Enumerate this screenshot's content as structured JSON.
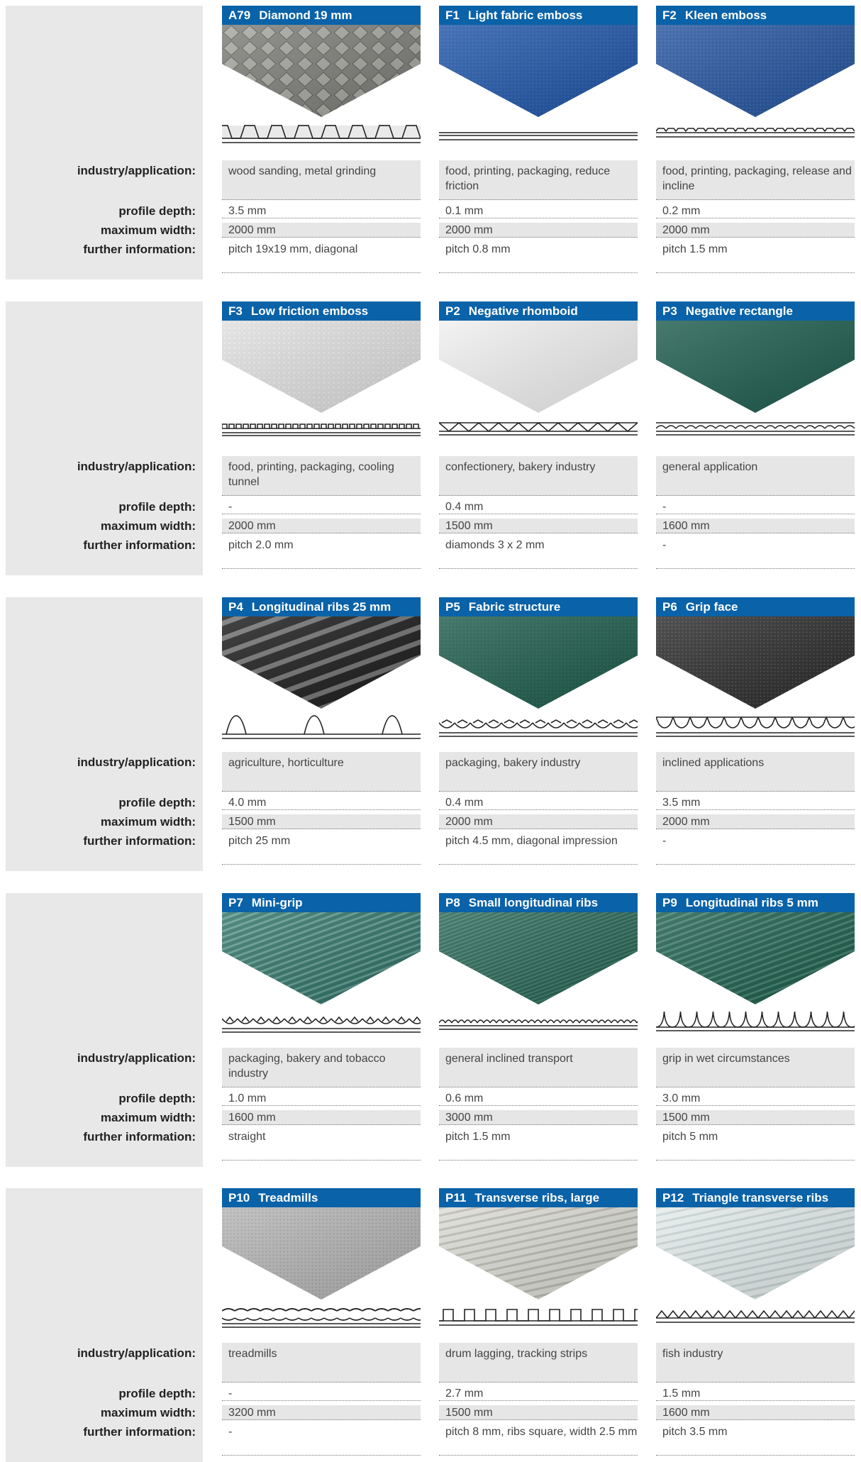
{
  "labels": {
    "industry": "industry/application:",
    "depth": "profile depth:",
    "width": "maximum width:",
    "info": "further information:"
  },
  "colors": {
    "header": "#0a62a8",
    "panel": "#e8e8e8"
  },
  "sections": [
    {
      "cards": [
        {
          "code": "A79",
          "name": "Diamond 19 mm",
          "swatch": "grey-diamond",
          "profile_icon": "diamond-profile",
          "industry": "wood sanding, metal grinding",
          "depth": "3.5 mm",
          "width": "2000 mm",
          "info": "pitch 19x19 mm, diagonal"
        },
        {
          "code": "F1",
          "name": "Light fabric emboss",
          "swatch": "blue-fabric",
          "profile_icon": "flat-profile",
          "industry": "food, printing, packaging, reduce friction",
          "depth": "0.1 mm",
          "width": "2000 mm",
          "info": "pitch 0.8 mm"
        },
        {
          "code": "F2",
          "name": "Kleen emboss",
          "swatch": "blue-emboss",
          "profile_icon": "fine-bumps-profile",
          "industry": "food, printing, packaging, release and incline",
          "depth": "0.2 mm",
          "width": "2000 mm",
          "info": "pitch 1.5 mm"
        }
      ]
    },
    {
      "cards": [
        {
          "code": "F3",
          "name": "Low friction emboss",
          "swatch": "white-emboss",
          "profile_icon": "bumps-profile",
          "industry": "food, printing, packaging, cooling tunnel",
          "depth": "-",
          "width": "2000 mm",
          "info": "pitch 2.0 mm"
        },
        {
          "code": "P2",
          "name": "Negative rhomboid",
          "swatch": "white-smooth",
          "profile_icon": "rhomboid-profile",
          "industry": "confectionery, bakery industry",
          "depth": "0.4 mm",
          "width": "1500 mm",
          "info": "diamonds 3 x 2 mm"
        },
        {
          "code": "P3",
          "name": "Negative rectangle",
          "swatch": "green-smooth",
          "profile_icon": "wave-profile",
          "industry": "general application",
          "depth": "-",
          "width": "1600 mm",
          "info": "-"
        }
      ]
    },
    {
      "cards": [
        {
          "code": "P4",
          "name": "Longitudinal ribs 25 mm",
          "swatch": "black-ribs",
          "profile_icon": "ribs-profile",
          "industry": "agriculture, horticulture",
          "depth": "4.0 mm",
          "width": "1500 mm",
          "info": "pitch 25 mm"
        },
        {
          "code": "P5",
          "name": "Fabric structure",
          "swatch": "green-fabric",
          "profile_icon": "fabric-profile",
          "industry": "packaging, bakery industry",
          "depth": "0.4 mm",
          "width": "2000 mm",
          "info": "pitch 4.5 mm, diagonal impression"
        },
        {
          "code": "P6",
          "name": "Grip face",
          "swatch": "black-grip",
          "profile_icon": "grip-profile",
          "industry": "inclined applications",
          "depth": "3.5 mm",
          "width": "2000 mm",
          "info": "-"
        }
      ]
    },
    {
      "cards": [
        {
          "code": "P7",
          "name": "Mini-grip",
          "swatch": "green-minigrip",
          "profile_icon": "minigrip-profile",
          "industry": "packaging, bakery and tobacco industry",
          "depth": "1.0 mm",
          "width": "1600 mm",
          "info": "straight"
        },
        {
          "code": "P8",
          "name": "Small longitudinal ribs",
          "swatch": "green-ribs",
          "profile_icon": "small-ribs-profile",
          "industry": "general inclined transport",
          "depth": "0.6 mm",
          "width": "3000 mm",
          "info": "pitch 1.5 mm"
        },
        {
          "code": "P9",
          "name": "Longitudinal ribs 5 mm",
          "swatch": "green-ribs-5",
          "profile_icon": "pointed-ribs-profile",
          "industry": "grip in wet circumstances",
          "depth": "3.0 mm",
          "width": "1500 mm",
          "info": "pitch 5 mm"
        }
      ]
    },
    {
      "cards": [
        {
          "code": "P10",
          "name": "Treadmills",
          "swatch": "grey-treadmill",
          "profile_icon": "treadmill-profile",
          "industry": "treadmills",
          "depth": "-",
          "width": "3200 mm",
          "info": "-"
        },
        {
          "code": "P11",
          "name": "Transverse ribs, large",
          "swatch": "white-ribs",
          "profile_icon": "square-ribs-profile",
          "industry": "drum lagging, tracking strips",
          "depth": "2.7 mm",
          "width": "1500 mm",
          "info": "pitch 8 mm, ribs square, width 2.5 mm"
        },
        {
          "code": "P12",
          "name": "Triangle transverse ribs",
          "swatch": "light-ribs",
          "profile_icon": "triangle-profile",
          "industry": "fish industry",
          "depth": "1.5 mm",
          "width": "1600 mm",
          "info": "pitch 3.5 mm"
        }
      ]
    }
  ]
}
